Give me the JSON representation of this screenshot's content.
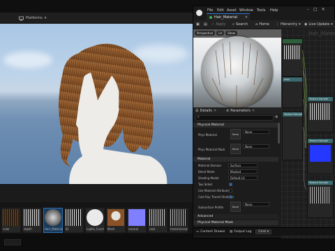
{
  "main_window": {
    "toolbar": {
      "platforms_label": "Platforms"
    },
    "content_browser": {
      "assets": [
        {
          "name": "color"
        },
        {
          "name": "depth"
        },
        {
          "name": "Hair_Material"
        },
        {
          "name": "ID"
        },
        {
          "name": "Lights_Function"
        },
        {
          "name": "Mesh"
        },
        {
          "name": "normal"
        },
        {
          "name": "root"
        },
        {
          "name": "transmission"
        }
      ],
      "selected_index": 2
    }
  },
  "material_editor": {
    "menu": [
      "File",
      "Edit",
      "Asset",
      "Window",
      "Tools",
      "Help"
    ],
    "tab_title": "Hair_Material",
    "toolbar": {
      "apply": "Apply",
      "search": "Search",
      "home": "Home",
      "hierarchy": "Hierarchy",
      "live_update": "Live Update"
    },
    "preview_tabs": [
      "Perspective",
      "Lit",
      "Show"
    ],
    "graph_title": "Hair_Material",
    "details_tabs": {
      "details": "Details",
      "parameters": "Parameters"
    },
    "sections": {
      "physical_material": "Physical Material",
      "material": "Material",
      "advanced": "Advanced",
      "physical_material_mask": "Physical Material Mask"
    },
    "properties": {
      "phys_material": {
        "label": "Phys Material",
        "value": "None"
      },
      "phys_material_mask": {
        "label": "Phys Material Mask",
        "value": "None"
      },
      "material_domain": {
        "label": "Material Domain",
        "value": "Surface"
      },
      "blend_mode": {
        "label": "Blend Mode",
        "value": "Masked"
      },
      "shading_model": {
        "label": "Shading Model",
        "value": "Default Lit"
      },
      "two_sided": {
        "label": "Two Sided",
        "checked": true
      },
      "use_material_attributes": {
        "label": "Use Material Attributes",
        "checked": false
      },
      "cast_ray_traced_shadows": {
        "label": "Cast Ray Traced Shadows",
        "checked": true
      },
      "subsurface_profile": {
        "label": "Subsurface Profile",
        "value": "None"
      }
    },
    "bottom_bar": {
      "content_drawer": "Content Drawer",
      "output_log": "Output Log",
      "cmd": "Cmd"
    },
    "nodes": [
      {
        "title": "Texture Sample"
      },
      {
        "title": "Texture Sample"
      },
      {
        "title": "Texture Sample"
      },
      {
        "title": "Texture Sample"
      },
      {
        "title": "Lerp"
      }
    ]
  },
  "colors": {
    "accent": "#2d7bd6",
    "hair_brown": "#8a5226",
    "node_header": "#3a6a6f"
  }
}
